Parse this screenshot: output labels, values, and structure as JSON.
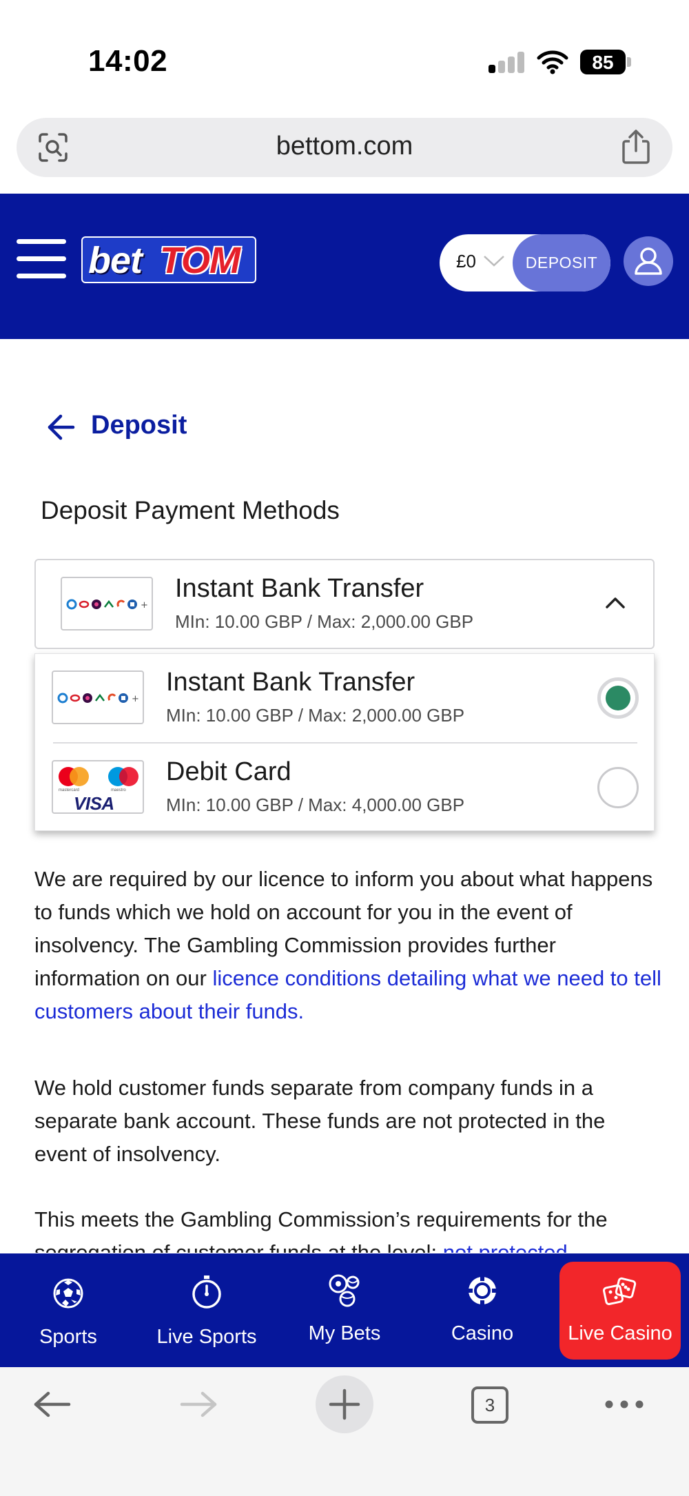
{
  "status_bar": {
    "time": "14:02",
    "battery": "85",
    "signal_bars_active": 1,
    "signal_bars_total": 4
  },
  "browser": {
    "url": "bettom.com",
    "lens_icon": "camera-search-icon",
    "share_icon": "share-icon",
    "tab_count": "3"
  },
  "header": {
    "logo_part1": "bet",
    "logo_part2": "TOM",
    "balance": "£0",
    "deposit_label": "DEPOSIT",
    "colors": {
      "background": "#06179b",
      "deposit": "#6874d8"
    }
  },
  "page": {
    "title": "Deposit",
    "section_title": "Deposit Payment Methods"
  },
  "payment_select": {
    "selected": {
      "name": "Instant Bank Transfer",
      "limits": "MIn: 10.00 GBP / Max: 2,000.00 GBP"
    },
    "options": [
      {
        "name": "Instant Bank Transfer",
        "limits": "MIn: 10.00 GBP / Max: 2,000.00 GBP",
        "checked": true,
        "logo": "bank-logos-icon"
      },
      {
        "name": "Debit Card",
        "limits": "MIn: 10.00 GBP / Max: 4,000.00 GBP",
        "checked": false,
        "logo": "card-logos-icon",
        "logo_captions": {
          "mastercard": "mastercard",
          "maestro": "maestro",
          "visa": "VISA"
        }
      }
    ]
  },
  "info": {
    "p1_text": "We are required by our licence to inform you about what happens to funds which we hold on account for you in the event of insolvency. The Gambling Commission provides further information on our ",
    "p1_link": "licence conditions detailing what we need to tell customers about their funds.",
    "p2": "We hold customer funds separate from company funds in a separate bank account. These funds are not protected in the event of insolvency.",
    "p3_text": "This meets the Gambling Commission’s requirements for the segregation of customer funds at the level: ",
    "p3_link": "not protected –"
  },
  "bottom_nav": [
    {
      "label": "Sports",
      "icon": "football-icon"
    },
    {
      "label": "Live Sports",
      "icon": "stopwatch-icon"
    },
    {
      "label": "My Bets",
      "icon": "balls-icon"
    },
    {
      "label": "Casino",
      "icon": "casino-chip-icon"
    },
    {
      "label": "Live Casino",
      "icon": "dice-icon",
      "active": true
    }
  ],
  "accent_colors": {
    "active_nav": "#f2262a",
    "link": "#1b2bd6",
    "radio_checked": "#2b8a64"
  }
}
